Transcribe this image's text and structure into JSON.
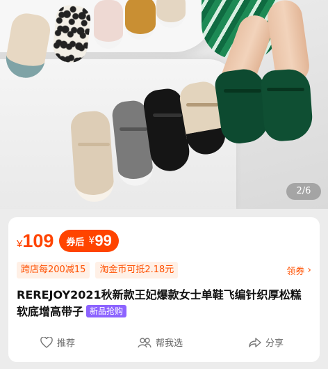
{
  "hero": {
    "image_counter": "2/6",
    "colors": {
      "green_shoe": "#0d4a30",
      "black_shoe": "#151515",
      "grey_shoe": "#7a7a7a",
      "beige_shoe": "#e6d6c0"
    }
  },
  "price": {
    "currency": "¥",
    "current": "109",
    "coupon_label": "券后",
    "coupon_currency": "¥",
    "coupon_price": "99"
  },
  "promos": {
    "tags": [
      "跨店每200减15",
      "淘金币可抵2.18元"
    ],
    "coupon_link": "领券",
    "coupon_chevron": "›"
  },
  "product": {
    "title": "REREJOY2021秋新款王妃爆款女士单鞋飞编针织厚松糕软底增高带子",
    "badge": "新品抢购"
  },
  "actions": {
    "recommend": "推荐",
    "help_choose": "帮我选",
    "share": "分享"
  },
  "theme": {
    "accent": "#ff4400",
    "badge": "#8c63ff"
  }
}
